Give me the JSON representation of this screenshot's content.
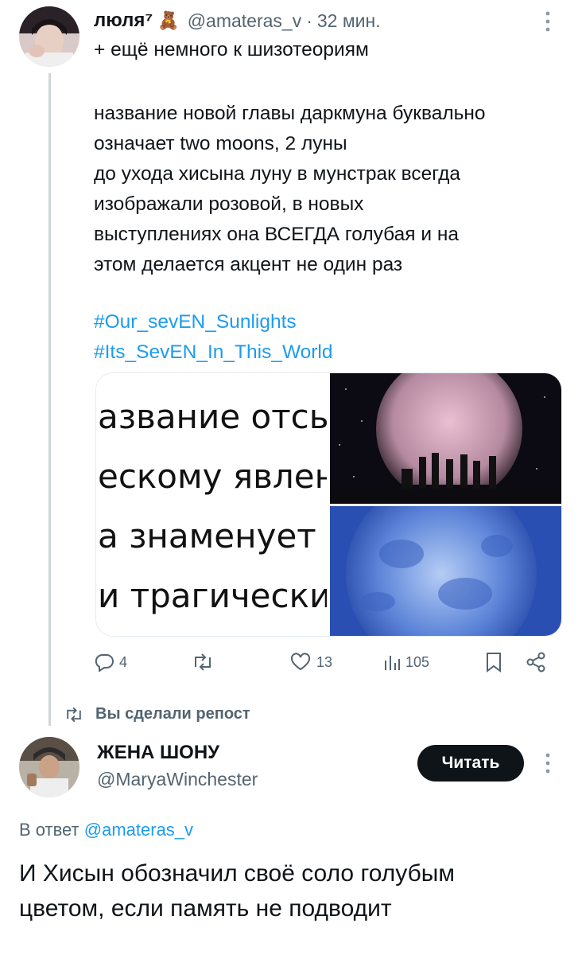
{
  "tweet": {
    "author_name": "люля⁷",
    "author_emoji_icon": "teddy-bear-icon",
    "handle": "@amateras_v",
    "separator": "·",
    "time": "32 мин.",
    "lines": [
      "+ ещё немного к шизотеориям",
      "",
      "название новой главы даркмуна буквально",
      "означает two moons, 2 луны",
      "до ухода хисына луну в мунстрак всегда",
      "изображали розовой, в новых",
      "выступлениях она ВСЕГДА голубая и на",
      "этом делается акцент не один раз"
    ],
    "hashtags": [
      "#Our_sevEN_Sunlights",
      "#Its_SevEN_In_This_World"
    ],
    "media_text_lines": [
      "азвание отсыл",
      "ескому явлени",
      "а знаменует п",
      "и трагически"
    ],
    "actions": {
      "replies": "4",
      "retweets": "",
      "likes": "13",
      "views": "105"
    }
  },
  "repost_banner": "Вы сделали репост",
  "reply": {
    "author_name": "ЖЕНА ШОНУ",
    "handle": "@MaryaWinchester",
    "follow_label": "Читать",
    "in_reply_prefix": "В ответ",
    "in_reply_handle": "@amateras_v",
    "text_lines": [
      "И Хисын обозначил своё соло голубым",
      "цветом, если память не подводит"
    ]
  },
  "colors": {
    "link": "#1d9bf0",
    "muted": "#536471",
    "thread_line": "#d0d6db",
    "follow_button": "#0f1419"
  }
}
